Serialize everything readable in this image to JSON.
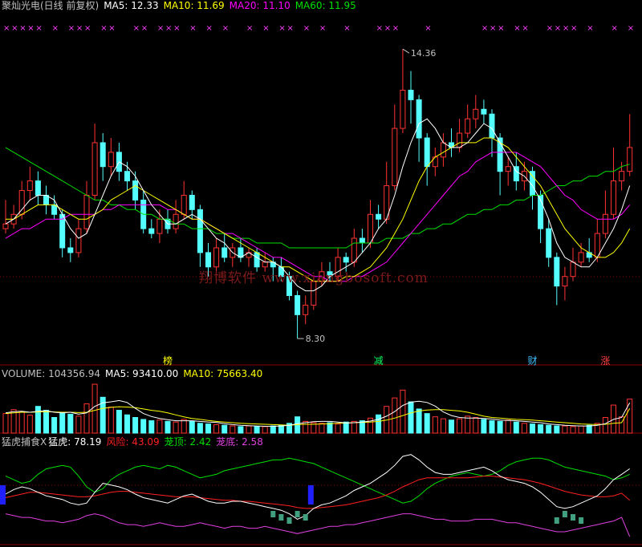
{
  "header": {
    "stock_name": "聚灿光电(日线 前复权)",
    "ma5": "MA5: 12.33",
    "ma10": "MA10: 11.69",
    "ma20": "MA20: 11.10",
    "ma60": "MA60: 11.95"
  },
  "volume_header": {
    "label": "VOLUME: 104356.94",
    "ma5": "MA5: 93410.00",
    "ma10": "MA10: 75663.40"
  },
  "indicator_header": {
    "name": "猛虎捕食X",
    "tiger": "猛虎: 78.19",
    "risk": "风险: 43.09",
    "top": "茏顶: 2.42",
    "bottom": "茏底: 2.58"
  },
  "annotations": {
    "high": "14.36",
    "low": "8.30",
    "tags": [
      "榜",
      "减",
      "财",
      "涨"
    ]
  },
  "watermark": "翔博软件 www.xiangbosoft.com",
  "colors": {
    "up": "#ff3232",
    "down": "#54ffff",
    "ma5": "#ffffff",
    "ma10": "#ffff00",
    "ma20": "#ff00ff",
    "ma60": "#00e000",
    "risk": "#ff2020",
    "top": "#00e000",
    "bottom": "#e040e0",
    "grid": "#8b0000"
  },
  "chart_data": [
    {
      "type": "candlestick",
      "title": "聚灿光电(日线 前复权)",
      "ylim": [
        8.0,
        14.8
      ],
      "series_names": [
        "MA5",
        "MA10",
        "MA20",
        "MA60"
      ],
      "candles": [
        [
          10.6,
          10.7,
          11.2,
          10.5
        ],
        [
          10.7,
          10.9,
          11.1,
          10.6
        ],
        [
          10.9,
          11.4,
          11.6,
          10.8
        ],
        [
          11.4,
          11.6,
          11.9,
          11.2
        ],
        [
          11.6,
          11.3,
          11.8,
          11.1
        ],
        [
          11.3,
          11.1,
          11.5,
          10.9
        ],
        [
          11.1,
          10.9,
          11.3,
          10.8
        ],
        [
          10.9,
          10.2,
          11.0,
          10.0
        ],
        [
          10.2,
          10.1,
          10.4,
          9.9
        ],
        [
          10.1,
          10.6,
          10.8,
          10.0
        ],
        [
          10.6,
          11.3,
          11.6,
          10.5
        ],
        [
          11.3,
          12.4,
          12.8,
          11.2
        ],
        [
          12.4,
          11.9,
          12.6,
          11.6
        ],
        [
          11.9,
          12.2,
          12.5,
          11.7
        ],
        [
          12.2,
          11.8,
          12.4,
          11.6
        ],
        [
          11.8,
          11.6,
          12.0,
          11.4
        ],
        [
          11.6,
          11.2,
          11.8,
          11.0
        ],
        [
          11.2,
          10.6,
          11.4,
          10.5
        ],
        [
          10.6,
          10.5,
          10.8,
          10.4
        ],
        [
          10.5,
          10.8,
          11.0,
          10.3
        ],
        [
          10.8,
          10.6,
          11.0,
          10.5
        ],
        [
          10.6,
          10.9,
          11.2,
          10.5
        ],
        [
          10.9,
          11.3,
          11.6,
          10.8
        ],
        [
          11.3,
          11.0,
          11.4,
          10.8
        ],
        [
          11.0,
          10.1,
          11.1,
          9.8
        ],
        [
          10.1,
          9.8,
          10.3,
          9.6
        ],
        [
          9.8,
          10.2,
          10.4,
          9.5
        ],
        [
          10.2,
          10.0,
          10.5,
          9.9
        ],
        [
          10.0,
          10.2,
          10.3,
          9.8
        ],
        [
          10.2,
          10.0,
          10.4,
          9.9
        ],
        [
          10.0,
          10.1,
          10.2,
          9.8
        ],
        [
          10.1,
          9.8,
          10.2,
          9.7
        ],
        [
          9.8,
          9.9,
          10.1,
          9.7
        ],
        [
          9.9,
          9.8,
          10.0,
          9.5
        ],
        [
          9.8,
          9.6,
          10.0,
          9.5
        ],
        [
          9.6,
          9.2,
          9.7,
          9.1
        ],
        [
          9.2,
          8.8,
          9.3,
          8.3
        ],
        [
          8.8,
          9.0,
          9.2,
          8.6
        ],
        [
          9.0,
          9.5,
          9.6,
          8.9
        ],
        [
          9.5,
          9.7,
          9.9,
          9.4
        ],
        [
          9.7,
          9.6,
          9.9,
          9.5
        ],
        [
          9.6,
          10.0,
          10.2,
          9.5
        ],
        [
          10.0,
          9.9,
          10.1,
          9.7
        ],
        [
          9.9,
          10.4,
          10.6,
          9.8
        ],
        [
          10.4,
          10.3,
          10.6,
          10.1
        ],
        [
          10.3,
          10.9,
          11.2,
          10.2
        ],
        [
          10.9,
          10.8,
          11.1,
          10.6
        ],
        [
          10.8,
          11.5,
          12.0,
          10.7
        ],
        [
          11.5,
          12.7,
          13.2,
          11.4
        ],
        [
          12.7,
          13.5,
          14.36,
          12.6
        ],
        [
          13.5,
          13.3,
          13.9,
          12.8
        ],
        [
          13.3,
          12.5,
          13.4,
          12.0
        ],
        [
          12.5,
          11.9,
          12.6,
          11.5
        ],
        [
          11.9,
          12.1,
          12.3,
          11.7
        ],
        [
          12.1,
          12.4,
          12.6,
          11.9
        ],
        [
          12.4,
          12.3,
          12.7,
          12.1
        ],
        [
          12.3,
          12.6,
          12.9,
          12.2
        ],
        [
          12.6,
          12.9,
          13.2,
          12.5
        ],
        [
          12.9,
          13.1,
          13.4,
          12.7
        ],
        [
          13.1,
          13.0,
          13.3,
          12.8
        ],
        [
          13.0,
          12.5,
          13.1,
          12.1
        ],
        [
          12.5,
          11.8,
          12.6,
          11.3
        ],
        [
          11.8,
          11.9,
          12.1,
          11.5
        ],
        [
          11.9,
          11.6,
          12.2,
          11.4
        ],
        [
          11.6,
          11.8,
          12.0,
          11.4
        ],
        [
          11.8,
          11.3,
          11.9,
          11.0
        ],
        [
          11.3,
          10.6,
          11.4,
          10.3
        ],
        [
          10.6,
          10.0,
          10.8,
          9.8
        ],
        [
          10.0,
          9.4,
          10.1,
          9.0
        ],
        [
          9.4,
          9.6,
          9.8,
          9.1
        ],
        [
          9.6,
          9.9,
          10.2,
          9.5
        ],
        [
          9.9,
          10.1,
          10.3,
          9.8
        ],
        [
          10.1,
          10.0,
          10.4,
          9.9
        ],
        [
          10.0,
          10.5,
          10.8,
          9.9
        ],
        [
          10.5,
          10.9,
          11.4,
          10.4
        ],
        [
          10.9,
          11.6,
          12.3,
          10.8
        ],
        [
          11.6,
          11.8,
          12.0,
          11.4
        ],
        [
          11.8,
          12.3,
          13.0,
          11.7
        ]
      ],
      "ma5": [
        10.7,
        10.8,
        11.0,
        11.2,
        11.3,
        11.3,
        11.2,
        10.9,
        10.6,
        10.4,
        10.5,
        10.9,
        11.3,
        11.7,
        12.0,
        11.9,
        11.7,
        11.4,
        11.1,
        10.9,
        10.7,
        10.7,
        10.8,
        10.9,
        10.8,
        10.6,
        10.4,
        10.3,
        10.1,
        10.0,
        10.1,
        10.0,
        9.9,
        9.9,
        9.8,
        9.6,
        9.4,
        9.3,
        9.3,
        9.4,
        9.6,
        9.7,
        9.8,
        9.9,
        10.1,
        10.3,
        10.6,
        10.8,
        11.3,
        11.9,
        12.4,
        12.8,
        12.9,
        12.7,
        12.4,
        12.3,
        12.3,
        12.4,
        12.6,
        12.8,
        12.7,
        12.4,
        12.1,
        11.8,
        11.7,
        11.5,
        11.2,
        10.8,
        10.3,
        10.0,
        9.9,
        9.8,
        9.8,
        10.0,
        10.3,
        10.6,
        11.0,
        11.5
      ],
      "ma10": [
        10.8,
        10.8,
        10.9,
        11.0,
        11.1,
        11.1,
        11.1,
        11.0,
        10.9,
        10.8,
        10.8,
        10.9,
        11.0,
        11.2,
        11.3,
        11.4,
        11.5,
        11.4,
        11.3,
        11.2,
        11.1,
        11.0,
        10.9,
        10.8,
        10.8,
        10.7,
        10.6,
        10.5,
        10.4,
        10.3,
        10.2,
        10.1,
        10.0,
        9.9,
        9.8,
        9.8,
        9.7,
        9.6,
        9.5,
        9.5,
        9.5,
        9.5,
        9.6,
        9.6,
        9.7,
        9.8,
        10.0,
        10.2,
        10.5,
        10.8,
        11.2,
        11.6,
        11.9,
        12.1,
        12.2,
        12.3,
        12.4,
        12.4,
        12.4,
        12.5,
        12.5,
        12.4,
        12.3,
        12.1,
        11.9,
        11.7,
        11.5,
        11.2,
        10.9,
        10.6,
        10.4,
        10.2,
        10.1,
        10.0,
        10.0,
        10.1,
        10.3,
        10.6
      ],
      "ma20": [
        10.4,
        10.5,
        10.6,
        10.6,
        10.7,
        10.8,
        10.8,
        10.8,
        10.9,
        10.9,
        10.9,
        10.9,
        11.0,
        11.0,
        11.1,
        11.1,
        11.1,
        11.1,
        11.1,
        11.1,
        11.0,
        11.0,
        10.9,
        10.8,
        10.8,
        10.7,
        10.6,
        10.5,
        10.5,
        10.4,
        10.3,
        10.2,
        10.1,
        10.0,
        10.0,
        9.9,
        9.8,
        9.7,
        9.6,
        9.6,
        9.5,
        9.5,
        9.5,
        9.6,
        9.6,
        9.7,
        9.8,
        9.9,
        10.1,
        10.3,
        10.5,
        10.7,
        10.9,
        11.1,
        11.3,
        11.5,
        11.7,
        11.8,
        12.0,
        12.1,
        12.2,
        12.2,
        12.2,
        12.2,
        12.1,
        12.0,
        11.9,
        11.7,
        11.5,
        11.3,
        11.2,
        11.0,
        10.9,
        10.8,
        10.8,
        10.8,
        10.9,
        11.1
      ],
      "ma60": [
        12.3,
        12.2,
        12.1,
        12.0,
        11.9,
        11.8,
        11.7,
        11.6,
        11.5,
        11.4,
        11.3,
        11.2,
        11.2,
        11.1,
        11.1,
        11.0,
        11.0,
        10.9,
        10.9,
        10.8,
        10.8,
        10.7,
        10.7,
        10.6,
        10.6,
        10.6,
        10.5,
        10.5,
        10.4,
        10.4,
        10.4,
        10.3,
        10.3,
        10.3,
        10.3,
        10.2,
        10.2,
        10.2,
        10.2,
        10.2,
        10.2,
        10.2,
        10.2,
        10.3,
        10.3,
        10.3,
        10.3,
        10.4,
        10.4,
        10.4,
        10.5,
        10.5,
        10.6,
        10.6,
        10.7,
        10.7,
        10.8,
        10.9,
        10.9,
        11.0,
        11.0,
        11.1,
        11.1,
        11.2,
        11.2,
        11.3,
        11.3,
        11.4,
        11.5,
        11.5,
        11.6,
        11.6,
        11.7,
        11.7,
        11.8,
        11.8,
        11.9,
        11.95
      ]
    },
    {
      "type": "bar",
      "title": "VOLUME",
      "ylim": [
        0,
        160000
      ],
      "series_names": [
        "VOLUME",
        "MA5",
        "MA10"
      ],
      "values": [
        60000,
        72000,
        66000,
        55000,
        82000,
        70000,
        48000,
        62000,
        58000,
        52000,
        90000,
        150000,
        110000,
        80000,
        70000,
        56000,
        48000,
        42000,
        38000,
        40000,
        36000,
        34000,
        42000,
        36000,
        30000,
        28000,
        26000,
        24000,
        22000,
        20000,
        22000,
        21000,
        20000,
        22000,
        24000,
        30000,
        50000,
        36000,
        32000,
        30000,
        32000,
        28000,
        34000,
        36000,
        38000,
        46000,
        56000,
        82000,
        108000,
        132000,
        96000,
        74000,
        60000,
        50000,
        44000,
        40000,
        44000,
        52000,
        48000,
        42000,
        38000,
        36000,
        40000,
        34000,
        30000,
        28000,
        26000,
        24000,
        22000,
        22000,
        20000,
        22000,
        24000,
        30000,
        48000,
        86000,
        50000,
        104356.94
      ],
      "ma5": [
        62000,
        66000,
        67000,
        64000,
        67000,
        69000,
        64000,
        62000,
        64000,
        58000,
        62000,
        82000,
        93000,
        96000,
        100000,
        94000,
        76000,
        60000,
        51000,
        45000,
        41000,
        38000,
        38000,
        38000,
        36000,
        34000,
        33000,
        29000,
        26000,
        24000,
        23000,
        22000,
        21000,
        21000,
        22000,
        24000,
        29000,
        32000,
        35000,
        36000,
        36000,
        34000,
        31000,
        32000,
        34000,
        37000,
        42000,
        52000,
        66000,
        85000,
        95000,
        98000,
        94000,
        83000,
        65000,
        54000,
        48000,
        46000,
        46000,
        45000,
        43000,
        40000,
        39000,
        38000,
        36000,
        34000,
        32000,
        28000,
        26000,
        24000,
        23000,
        22000,
        22000,
        24000,
        29000,
        42000,
        48000,
        93410
      ],
      "ma10": [
        60000,
        62000,
        64000,
        64000,
        65000,
        66000,
        65000,
        64000,
        64000,
        63000,
        64000,
        70000,
        76000,
        79000,
        81000,
        80000,
        78000,
        74000,
        70000,
        67000,
        62000,
        56000,
        50000,
        45000,
        42000,
        39000,
        36000,
        34000,
        32000,
        30000,
        29000,
        28000,
        27000,
        26000,
        25000,
        24000,
        26000,
        27000,
        27000,
        28000,
        29000,
        30000,
        31000,
        32000,
        33000,
        34000,
        36000,
        40000,
        46000,
        54000,
        62000,
        68000,
        71000,
        72000,
        72000,
        70000,
        68000,
        64000,
        58000,
        52000,
        48000,
        46000,
        44000,
        42000,
        41000,
        40000,
        38000,
        36000,
        34000,
        32000,
        30000,
        28000,
        27000,
        26000,
        27000,
        30000,
        32000,
        75663.4
      ]
    },
    {
      "type": "line",
      "title": "猛虎捕食X",
      "ylim": [
        0,
        100
      ],
      "series_names": [
        "猛虎",
        "风险",
        "茏顶",
        "茏底"
      ],
      "tiger": [
        50,
        55,
        58,
        56,
        52,
        48,
        46,
        44,
        40,
        38,
        40,
        52,
        62,
        60,
        58,
        55,
        50,
        46,
        44,
        42,
        40,
        44,
        48,
        50,
        46,
        42,
        40,
        40,
        42,
        42,
        40,
        38,
        36,
        34,
        32,
        28,
        22,
        26,
        34,
        38,
        40,
        44,
        48,
        54,
        58,
        62,
        68,
        74,
        82,
        92,
        94,
        88,
        80,
        74,
        72,
        72,
        74,
        76,
        78,
        80,
        76,
        70,
        66,
        64,
        62,
        58,
        52,
        44,
        36,
        34,
        36,
        40,
        44,
        48,
        56,
        66,
        72,
        78.19
      ],
      "risk": [
        46,
        48,
        50,
        52,
        52,
        51,
        50,
        49,
        48,
        47,
        47,
        48,
        50,
        52,
        53,
        53,
        52,
        51,
        50,
        49,
        48,
        47,
        47,
        47,
        46,
        45,
        44,
        43,
        43,
        42,
        42,
        41,
        40,
        39,
        38,
        37,
        35,
        34,
        34,
        35,
        36,
        37,
        38,
        40,
        42,
        44,
        46,
        49,
        53,
        58,
        62,
        66,
        68,
        68,
        68,
        68,
        68,
        68,
        69,
        70,
        70,
        69,
        68,
        67,
        66,
        64,
        62,
        59,
        56,
        53,
        51,
        49,
        48,
        47,
        47,
        48,
        51,
        43.09
      ],
      "top": [
        70,
        66,
        62,
        64,
        72,
        78,
        80,
        82,
        80,
        70,
        58,
        52,
        56,
        66,
        72,
        76,
        80,
        82,
        80,
        78,
        82,
        80,
        76,
        72,
        68,
        70,
        72,
        76,
        78,
        80,
        82,
        84,
        86,
        88,
        88,
        90,
        88,
        86,
        84,
        80,
        76,
        72,
        68,
        64,
        60,
        56,
        52,
        48,
        44,
        40,
        42,
        48,
        56,
        62,
        66,
        70,
        72,
        74,
        72,
        70,
        72,
        76,
        82,
        86,
        88,
        90,
        90,
        88,
        84,
        80,
        78,
        76,
        74,
        72,
        70,
        66,
        68,
        72
      ],
      "bottom": [
        28,
        26,
        24,
        24,
        22,
        20,
        20,
        18,
        20,
        22,
        26,
        28,
        26,
        22,
        18,
        16,
        16,
        14,
        16,
        18,
        16,
        14,
        14,
        16,
        18,
        16,
        14,
        12,
        14,
        14,
        12,
        12,
        14,
        12,
        10,
        8,
        6,
        8,
        10,
        12,
        14,
        14,
        16,
        16,
        18,
        20,
        22,
        24,
        26,
        28,
        28,
        26,
        24,
        22,
        22,
        20,
        20,
        20,
        22,
        22,
        22,
        20,
        18,
        18,
        16,
        14,
        12,
        10,
        8,
        8,
        10,
        12,
        14,
        16,
        18,
        20,
        24,
        2.58
      ]
    }
  ]
}
